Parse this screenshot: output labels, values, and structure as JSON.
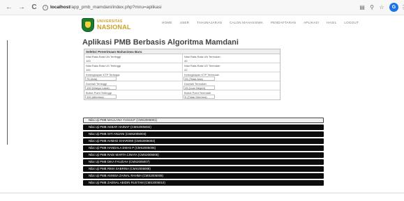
{
  "browser": {
    "back_label": "←",
    "forward_label": "→",
    "reload_label": "C",
    "url_host": "localhost",
    "url_path": "/app_pmb_mamdani/index.php?mnu=aplikasi",
    "profile_initial": "G"
  },
  "header": {
    "logo_line1": "UNIVERSITAS",
    "logo_line2": "NASIONAL",
    "menu": [
      "HOME",
      "USER",
      "TAHUNAJARAN",
      "CALON MAHASISWA",
      "PENDAFTARAN",
      "APLIKASI",
      "HASIL",
      "LOGOUT"
    ]
  },
  "main": {
    "title": "Aplikasi PMB Berbasis Algoritma Mamdani",
    "table_header": "Seleksi Penerimaan Mahasiswa Baru",
    "rows": [
      {
        "left_label": "Nilai Rata-Rata UN Tertinggi",
        "left_value": "100",
        "right_label": "Nilai Rata-Rata UN Terendah",
        "right_value": "40"
      },
      {
        "left_label": "Nilai Rata-Rata US Tertinggi",
        "left_value": "100",
        "right_label": "Nilai Rata-Rata US Terendah",
        "right_value": "20"
      },
      {
        "left_label": "Kelengkapan KTP Tertinggi",
        "left_value": "75 (Ada)",
        "right_label": "Kelengkapan KTP Terendah",
        "right_value": "25 (Tidak Ada)"
      },
      {
        "left_label": "Domisili Tertinggi",
        "left_value": "100 (Warga Lokal)",
        "right_label": "Domisili Terendah",
        "right_value": "25 (Luar Negeri)"
      },
      {
        "left_label": "Bobot Point Tertinggi",
        "left_value": "100 (diterima)",
        "right_label": "Bobot Point Terendah",
        "right_value": "0 (Tidak Diterima)"
      }
    ]
  },
  "results": [
    "Nilai Uji PMB MAULANA YUSUUF (CMS2005001)",
    "Nilai Uji PMB AKBAR HAINAF (CMS2005002)",
    "Nilai Uji PMB SITI ANJANI (CMS2005003)",
    "Nilai Uji PMB AHMAD SHAROMI (CMS2005004)",
    "Nilai Uji PMB HANDALA EMAS P (CMS2005005)",
    "Nilai Uji PMB RADI MARTA CINATA (CMS2005006)",
    "Nilai Uji PMB DIKA FAUZIAH (CMS2005007)",
    "Nilai Uji PMB RIMA SABRINA (CMS2005008)",
    "Nilai Uji PMB ANNISA ZAINAL RAHMA (CMS2005009)",
    "Nilai Uji PMB ZAENAL ABIDIN RUSTAM (CMS2005010)"
  ],
  "colors": {
    "accent_gold": "#c9a227",
    "logo_green": "#1e7a2c",
    "list_bg": "#0d0d0d",
    "profile_blue": "#1a73e8"
  }
}
